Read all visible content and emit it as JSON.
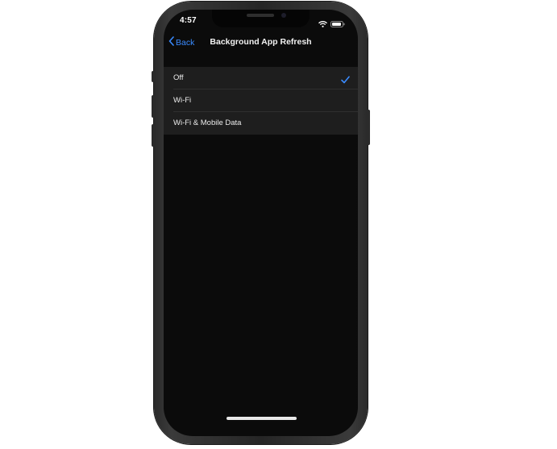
{
  "status_bar": {
    "time": "4:57",
    "icons": [
      "wifi-icon",
      "battery-icon"
    ]
  },
  "nav": {
    "back_label": "Back",
    "title": "Background App Refresh"
  },
  "options": [
    {
      "label": "Off",
      "selected": true
    },
    {
      "label": "Wi-Fi",
      "selected": false
    },
    {
      "label": "Wi-Fi & Mobile Data",
      "selected": false
    }
  ],
  "colors": {
    "accent": "#3a8bff",
    "screen_bg": "#0b0b0b",
    "group_bg": "#1e1e1e"
  }
}
